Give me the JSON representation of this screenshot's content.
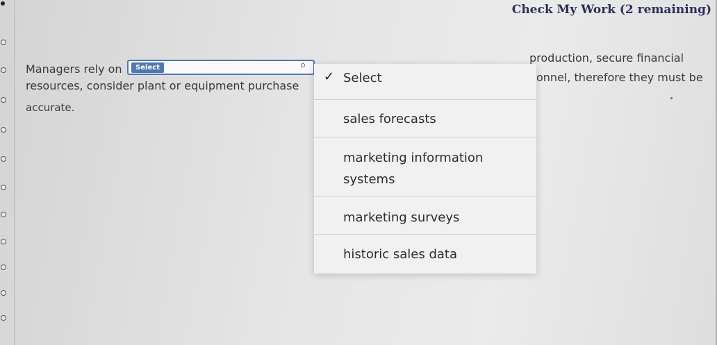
{
  "header": {
    "check_link": "Check My Work (2 remaining)"
  },
  "question": {
    "line1_start": "Managers rely on",
    "line1_end": "production, secure financial",
    "line2_start": "resources, consider plant or equipment purchase",
    "line2_end": "onnel, therefore they must be",
    "line3": "accurate.",
    "select_label": "Select"
  },
  "dropdown": {
    "selected": "Select",
    "options": [
      {
        "label": "sales forecasts"
      },
      {
        "label": "marketing information systems"
      },
      {
        "label": "marketing surveys"
      },
      {
        "label": "historic sales data"
      }
    ]
  }
}
